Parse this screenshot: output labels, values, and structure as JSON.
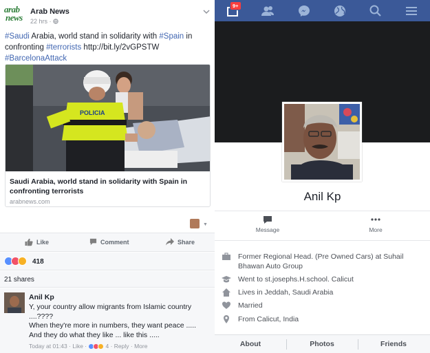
{
  "post": {
    "page_name": "Arab News",
    "logo_text_line1": "arab",
    "logo_text_line2": "news",
    "time": "22 hrs · ",
    "text_parts": [
      {
        "t": "#Saudi",
        "tag": true
      },
      {
        "t": " Arabia, world stand in solidarity with ",
        "tag": false
      },
      {
        "t": "#Spain",
        "tag": true
      },
      {
        "t": " in confronting ",
        "tag": false
      },
      {
        "t": "#terrorists",
        "tag": true
      },
      {
        "t": " http://bit.ly/2vGPSTW ",
        "tag": false
      },
      {
        "t": "#BarcelonaAttack",
        "tag": true
      }
    ],
    "link_title": "Saudi Arabia, world stand in solidarity with Spain in confronting terrorists",
    "link_domain": "arabnews.com",
    "image_vest_text": "POLICIA"
  },
  "actions": {
    "like": "Like",
    "comment": "Comment",
    "share": "Share"
  },
  "reactions": {
    "count": "418",
    "colors": {
      "like": "#5890ff",
      "love": "#f25268",
      "sad": "#f7b125"
    }
  },
  "shares": "21 shares",
  "comment": {
    "author": "Anil Kp",
    "lines": [
      "Y, your country allow migrants from Islamic country ....????",
      "When they're more in numbers, they want peace .....",
      "And they do what they like ... like this ....."
    ],
    "time": "Today at 01:43",
    "like": "Like",
    "reaction_count": "4",
    "reply": "Reply",
    "more": "More"
  },
  "profile": {
    "notification_badge": "9+",
    "name": "Anil Kp",
    "message_label": "Message",
    "more_label": "More",
    "info": [
      {
        "icon": "briefcase-icon",
        "text": "Former Regional Head. (Pre Owned Cars) at Suhail Bhawan Auto Group"
      },
      {
        "icon": "graduation-cap-icon",
        "text": "Went to st.josephs.H.school. Calicut"
      },
      {
        "icon": "home-icon",
        "text": "Lives in Jeddah, Saudi Arabia"
      },
      {
        "icon": "heart-icon",
        "text": "Married"
      },
      {
        "icon": "location-pin-icon",
        "text": "From Calicut, India"
      }
    ],
    "tabs": [
      "About",
      "Photos",
      "Friends"
    ]
  },
  "colors": {
    "brand_blue": "#3b5998",
    "link_blue": "#4267b2",
    "notification_red": "#fa3e3e"
  }
}
